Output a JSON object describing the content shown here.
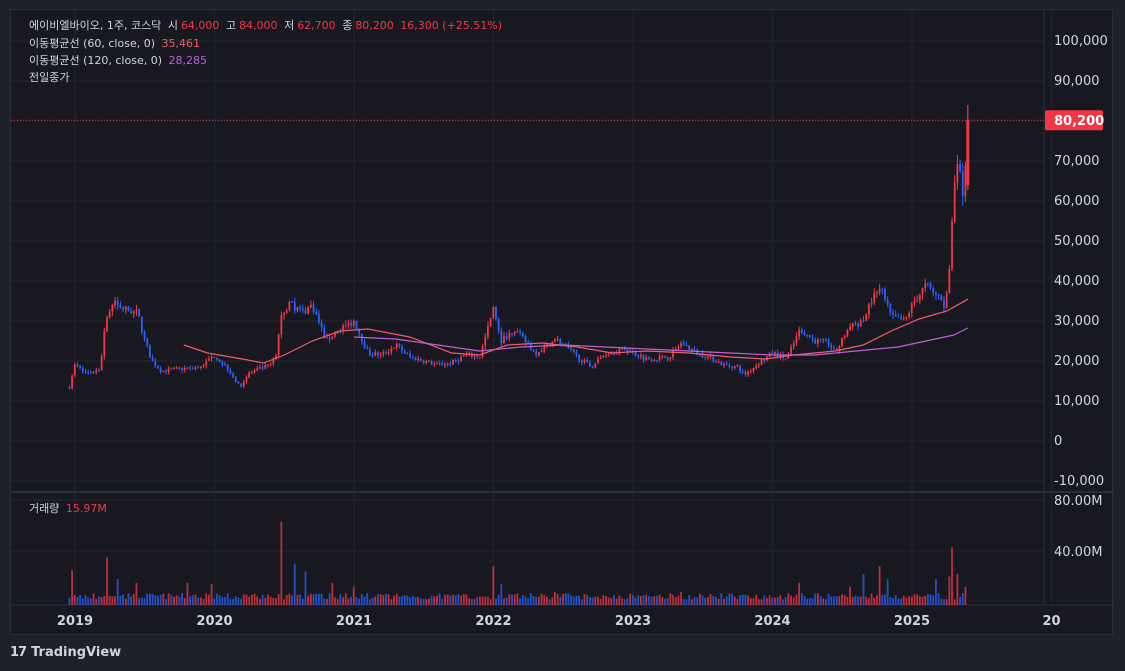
{
  "legend": {
    "symbol": "에이비엘바이오, 1주, 코스닥",
    "open_label": "시",
    "open": "64,000",
    "high_label": "고",
    "high": "84,000",
    "low_label": "저",
    "low": "62,700",
    "close_label": "종",
    "close": "80,200",
    "change": "16,300 (+25.51%)",
    "ma60_label": "이동평균선 (60, close, 0)",
    "ma60_value": "35,461",
    "ma120_label": "이동평균선 (120, close, 0)",
    "ma120_value": "28,285",
    "prev_close_label": "전일종가",
    "volume_label": "거래량",
    "volume_value": "15.97M"
  },
  "footer": {
    "brand": "TradingView",
    "logo_glyph": "17"
  },
  "colors": {
    "up": "#f23645",
    "down": "#2962ff",
    "ma60": "#f05a6a",
    "ma120": "#c05ed8",
    "bg": "#181920",
    "grid": "#23252e"
  },
  "chart_data": {
    "type": "candlestick",
    "price_axis": {
      "ticks": [
        "100,000",
        "90,000",
        "80,000",
        "70,000",
        "60,000",
        "50,000",
        "40,000",
        "30,000",
        "20,000",
        "10,000",
        "0",
        "-10,000"
      ],
      "range": [
        -10000,
        100000
      ]
    },
    "volume_axis": {
      "ticks": [
        "80.00M",
        "40.00M"
      ],
      "range": [
        0,
        80
      ]
    },
    "time_axis": {
      "ticks": [
        "2019",
        "2020",
        "2021",
        "2022",
        "2023",
        "2024",
        "2025",
        "20"
      ]
    },
    "last_price": 80200,
    "last_price_label": "80,200",
    "price_path": [
      [
        2018.96,
        13500
      ],
      [
        2019.0,
        19000
      ],
      [
        2019.05,
        17500
      ],
      [
        2019.1,
        17000
      ],
      [
        2019.18,
        18000
      ],
      [
        2019.22,
        31000
      ],
      [
        2019.28,
        34500
      ],
      [
        2019.35,
        33000
      ],
      [
        2019.45,
        32000
      ],
      [
        2019.5,
        25000
      ],
      [
        2019.55,
        20000
      ],
      [
        2019.62,
        17500
      ],
      [
        2019.75,
        18000
      ],
      [
        2019.9,
        18500
      ],
      [
        2020.0,
        21500
      ],
      [
        2020.1,
        18000
      ],
      [
        2020.18,
        13500
      ],
      [
        2020.25,
        17000
      ],
      [
        2020.4,
        19000
      ],
      [
        2020.44,
        21000
      ],
      [
        2020.48,
        32000
      ],
      [
        2020.55,
        34500
      ],
      [
        2020.62,
        32000
      ],
      [
        2020.7,
        34000
      ],
      [
        2020.8,
        25000
      ],
      [
        2020.9,
        28000
      ],
      [
        2021.0,
        30000
      ],
      [
        2021.1,
        22000
      ],
      [
        2021.2,
        21500
      ],
      [
        2021.3,
        24000
      ],
      [
        2021.4,
        21000
      ],
      [
        2021.5,
        20000
      ],
      [
        2021.6,
        19000
      ],
      [
        2021.7,
        19500
      ],
      [
        2021.8,
        21500
      ],
      [
        2021.9,
        21000
      ],
      [
        2022.0,
        33000
      ],
      [
        2022.05,
        25000
      ],
      [
        2022.15,
        28000
      ],
      [
        2022.3,
        22000
      ],
      [
        2022.45,
        25500
      ],
      [
        2022.6,
        21000
      ],
      [
        2022.7,
        18500
      ],
      [
        2022.8,
        22000
      ],
      [
        2022.95,
        23000
      ],
      [
        2023.1,
        20500
      ],
      [
        2023.25,
        21000
      ],
      [
        2023.35,
        24500
      ],
      [
        2023.45,
        22000
      ],
      [
        2023.55,
        21000
      ],
      [
        2023.65,
        19000
      ],
      [
        2023.75,
        18500
      ],
      [
        2023.8,
        16500
      ],
      [
        2023.9,
        19500
      ],
      [
        2024.0,
        22000
      ],
      [
        2024.1,
        20500
      ],
      [
        2024.2,
        28000
      ],
      [
        2024.3,
        25000
      ],
      [
        2024.4,
        24500
      ],
      [
        2024.45,
        22000
      ],
      [
        2024.55,
        28500
      ],
      [
        2024.65,
        30000
      ],
      [
        2024.7,
        34500
      ],
      [
        2024.77,
        38500
      ],
      [
        2024.85,
        31000
      ],
      [
        2024.95,
        30000
      ],
      [
        2025.0,
        34000
      ],
      [
        2025.1,
        39000
      ],
      [
        2025.18,
        36000
      ],
      [
        2025.24,
        33000
      ],
      [
        2025.27,
        44000
      ],
      [
        2025.3,
        64000
      ],
      [
        2025.33,
        68000
      ],
      [
        2025.37,
        62000
      ],
      [
        2025.4,
        80200
      ]
    ],
    "ma60_path": [
      [
        2019.78,
        24000
      ],
      [
        2019.95,
        22000
      ],
      [
        2020.2,
        20500
      ],
      [
        2020.35,
        19500
      ],
      [
        2020.5,
        21500
      ],
      [
        2020.7,
        25000
      ],
      [
        2020.9,
        27500
      ],
      [
        2021.1,
        28000
      ],
      [
        2021.4,
        26000
      ],
      [
        2021.7,
        22000
      ],
      [
        2021.9,
        21500
      ],
      [
        2022.1,
        24000
      ],
      [
        2022.35,
        24500
      ],
      [
        2022.6,
        23500
      ],
      [
        2022.85,
        22000
      ],
      [
        2023.1,
        22500
      ],
      [
        2023.4,
        22000
      ],
      [
        2023.7,
        21000
      ],
      [
        2023.95,
        20500
      ],
      [
        2024.15,
        21500
      ],
      [
        2024.45,
        22500
      ],
      [
        2024.65,
        24000
      ],
      [
        2024.85,
        27500
      ],
      [
        2025.05,
        30500
      ],
      [
        2025.25,
        32500
      ],
      [
        2025.4,
        35461
      ]
    ],
    "ma120_path": [
      [
        2021.0,
        26000
      ],
      [
        2021.3,
        25500
      ],
      [
        2021.6,
        24000
      ],
      [
        2021.9,
        22500
      ],
      [
        2022.2,
        23500
      ],
      [
        2022.5,
        24000
      ],
      [
        2022.8,
        23500
      ],
      [
        2023.1,
        23000
      ],
      [
        2023.4,
        22500
      ],
      [
        2023.7,
        22000
      ],
      [
        2024.0,
        21500
      ],
      [
        2024.3,
        21500
      ],
      [
        2024.6,
        22500
      ],
      [
        2024.9,
        23500
      ],
      [
        2025.1,
        25000
      ],
      [
        2025.3,
        26500
      ],
      [
        2025.4,
        28285
      ]
    ],
    "volume_spikes": [
      [
        2018.98,
        25
      ],
      [
        2019.22,
        35
      ],
      [
        2019.3,
        18
      ],
      [
        2019.45,
        15
      ],
      [
        2019.8,
        15
      ],
      [
        2019.98,
        14
      ],
      [
        2020.48,
        63
      ],
      [
        2020.58,
        30
      ],
      [
        2020.65,
        24
      ],
      [
        2020.85,
        15
      ],
      [
        2021.0,
        12
      ],
      [
        2022.0,
        28
      ],
      [
        2022.05,
        14
      ],
      [
        2022.45,
        8
      ],
      [
        2023.35,
        8
      ],
      [
        2024.2,
        15
      ],
      [
        2024.55,
        12
      ],
      [
        2024.65,
        22
      ],
      [
        2024.77,
        28
      ],
      [
        2024.82,
        18
      ],
      [
        2025.18,
        18
      ],
      [
        2025.27,
        20
      ],
      [
        2025.29,
        43
      ],
      [
        2025.32,
        22
      ],
      [
        2025.38,
        12
      ],
      [
        2025.4,
        15.97
      ]
    ]
  }
}
